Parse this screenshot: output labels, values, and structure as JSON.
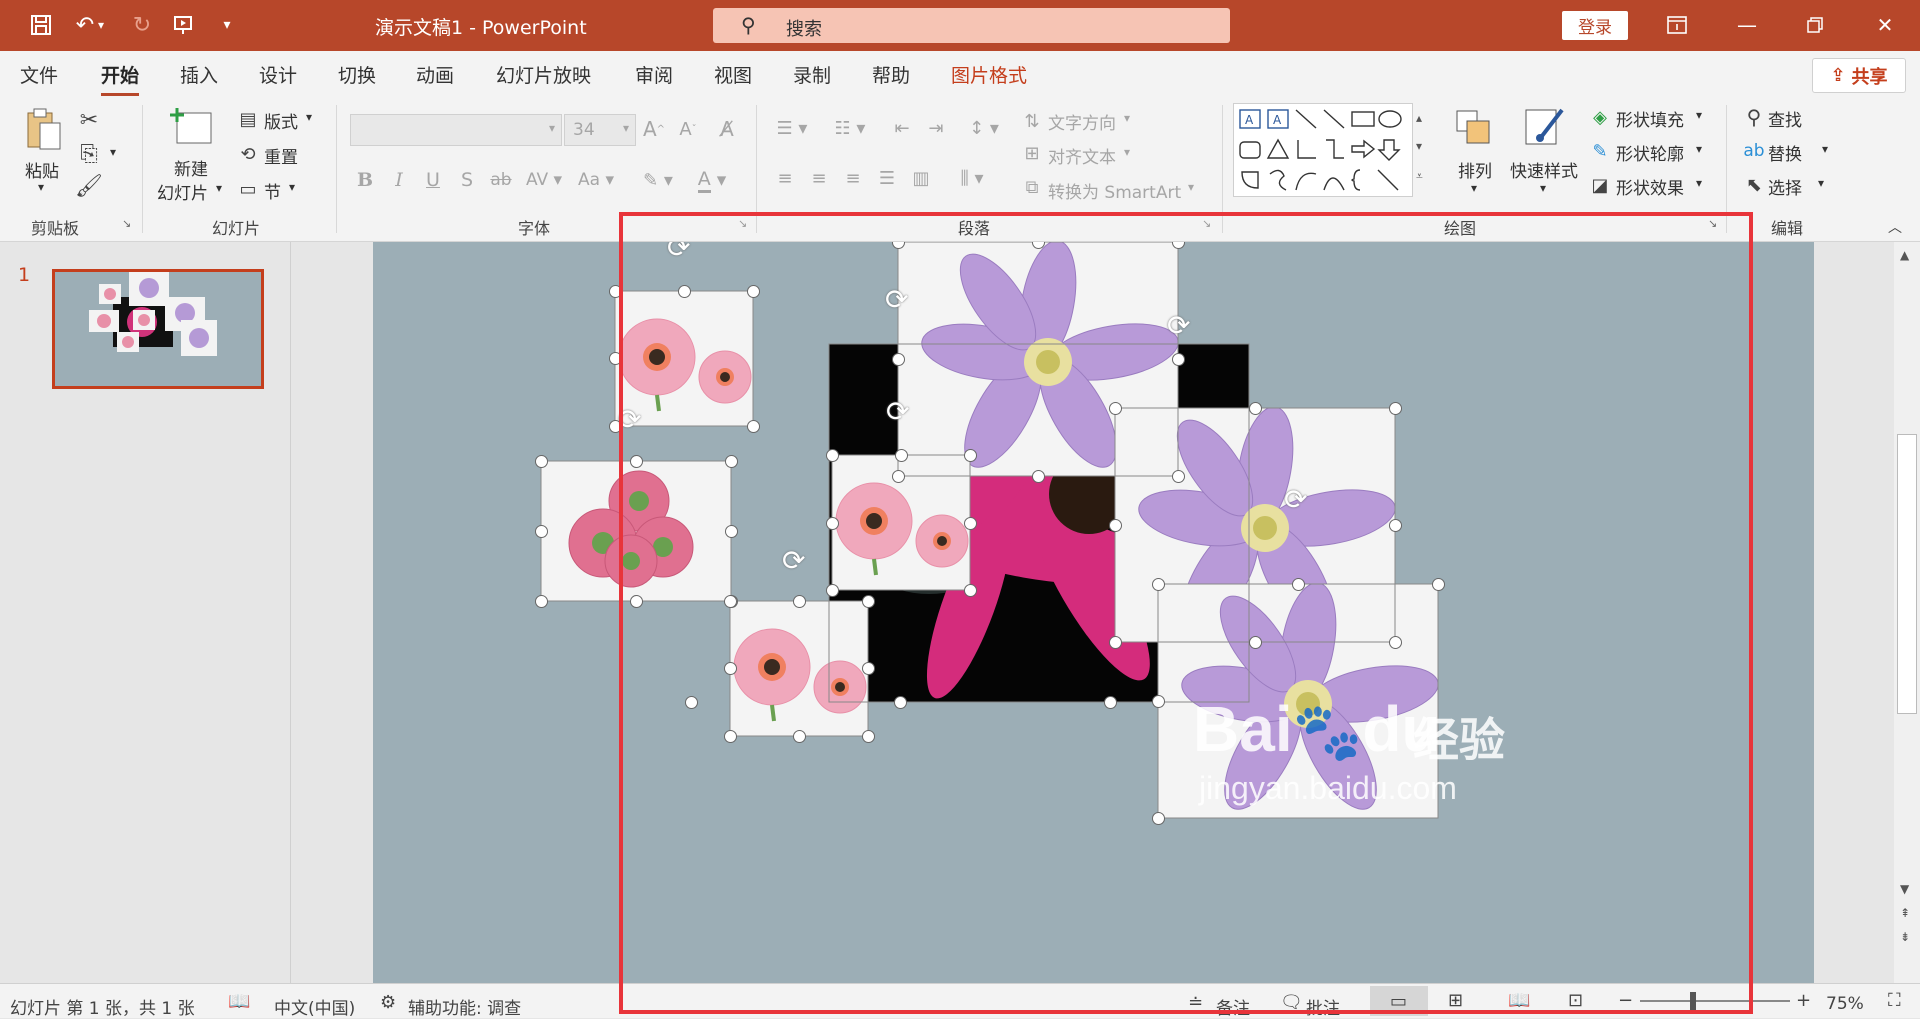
{
  "window": {
    "title": "演示文稿1 - PowerPoint",
    "search_placeholder": "搜索",
    "login_label": "登录",
    "share_label": "共享"
  },
  "tabs": [
    {
      "label": "文件"
    },
    {
      "label": "开始",
      "active": true
    },
    {
      "label": "插入"
    },
    {
      "label": "设计"
    },
    {
      "label": "切换"
    },
    {
      "label": "动画"
    },
    {
      "label": "幻灯片放映"
    },
    {
      "label": "审阅"
    },
    {
      "label": "视图"
    },
    {
      "label": "录制"
    },
    {
      "label": "帮助"
    },
    {
      "label": "图片格式",
      "contextual": true
    }
  ],
  "ribbon": {
    "clipboard": {
      "paste": "粘贴",
      "group": "剪贴板"
    },
    "slides": {
      "new_slide_1": "新建",
      "new_slide_2": "幻灯片",
      "layout": "版式",
      "reset": "重置",
      "section": "节",
      "group": "幻灯片"
    },
    "font": {
      "size": "34",
      "group": "字体"
    },
    "paragraph": {
      "text_direction": "文字方向",
      "align_text": "对齐文本",
      "smartart": "转换为 SmartArt",
      "group": "段落"
    },
    "drawing": {
      "arrange": "排列",
      "quick_styles": "快速样式",
      "shape_fill": "形状填充",
      "shape_outline": "形状轮廓",
      "shape_effects": "形状效果",
      "group": "绘图"
    },
    "editing": {
      "find": "查找",
      "replace": "替换",
      "select": "选择",
      "group": "编辑"
    }
  },
  "slide_panel": {
    "slide_number": "1"
  },
  "statusbar": {
    "slide_info": "幻灯片 第 1 张，共 1 张",
    "language": "中文(中国)",
    "accessibility": "辅助功能: 调查",
    "notes": "备注",
    "comments": "批注",
    "zoom": "75%"
  },
  "watermark": {
    "brand_1": "Bai",
    "brand_2": "du",
    "brand_cn": "经验",
    "url": "jingyan.baidu.com"
  },
  "colors": {
    "accent": "#b7472a",
    "slide_bg": "#9caeb6",
    "highlight": "#e8343a"
  }
}
